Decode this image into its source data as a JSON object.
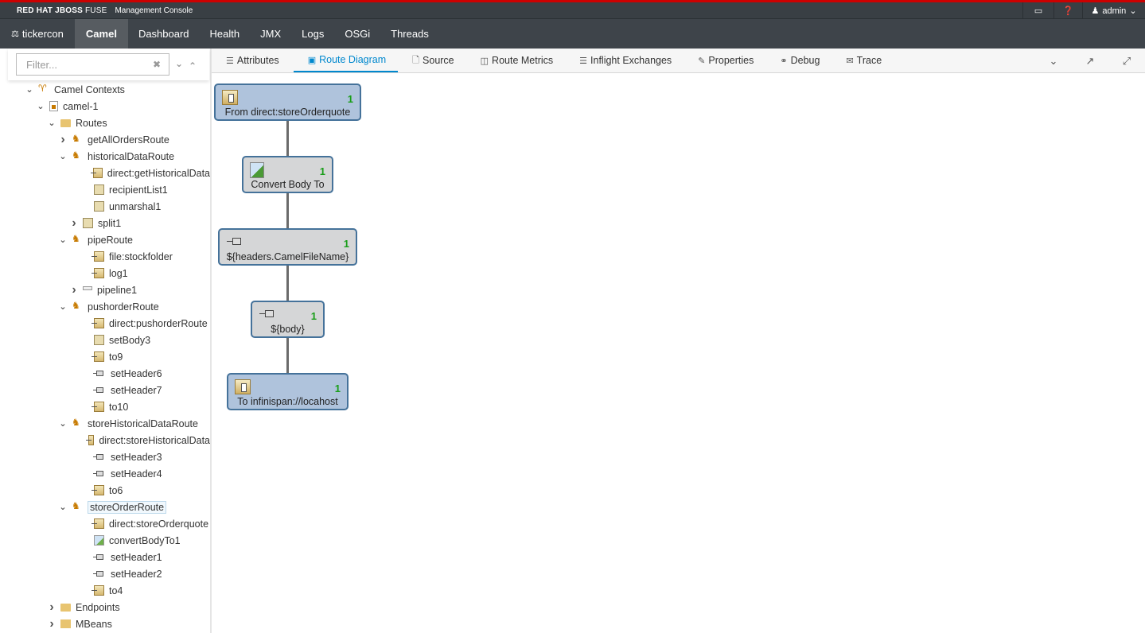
{
  "header": {
    "brand": "RED HAT JBOSS",
    "brand_product": "FUSE",
    "subtitle": "Management Console",
    "user": "admin"
  },
  "nav": {
    "items": [
      {
        "label": "tickercon",
        "icon": "flask-icon"
      },
      {
        "label": "Camel",
        "active": true
      },
      {
        "label": "Dashboard"
      },
      {
        "label": "Health"
      },
      {
        "label": "JMX"
      },
      {
        "label": "Logs"
      },
      {
        "label": "OSGi"
      },
      {
        "label": "Threads"
      }
    ]
  },
  "sidebar": {
    "filter_placeholder": "Filter...",
    "tree": {
      "root": "Camel Contexts",
      "context": "camel-1",
      "routes_folder": "Routes",
      "routes": [
        {
          "name": "getAllOrdersRoute",
          "expanded": false,
          "children": []
        },
        {
          "name": "historicalDataRoute",
          "expanded": true,
          "children": [
            "direct:getHistoricalData",
            "recipientList1",
            "unmarshal1",
            "split1"
          ]
        },
        {
          "name": "pipeRoute",
          "expanded": true,
          "children": [
            "file:stockfolder",
            "log1",
            "pipeline1"
          ]
        },
        {
          "name": "pushorderRoute",
          "expanded": true,
          "children": [
            "direct:pushorderRoute",
            "setBody3",
            "to9",
            "setHeader6",
            "setHeader7",
            "to10"
          ]
        },
        {
          "name": "storeHistoricalDataRoute",
          "expanded": true,
          "children": [
            "direct:storeHistoricalData",
            "setHeader3",
            "setHeader4",
            "to6"
          ]
        },
        {
          "name": "storeOrderRoute",
          "expanded": true,
          "selected": true,
          "children": [
            "direct:storeOrderquote",
            "convertBodyTo1",
            "setHeader1",
            "setHeader2",
            "to4"
          ]
        }
      ],
      "endpoints": "Endpoints",
      "mbeans": "MBeans"
    }
  },
  "tabs": [
    {
      "label": "Attributes",
      "icon": "list-icon"
    },
    {
      "label": "Route Diagram",
      "icon": "image-icon",
      "active": true
    },
    {
      "label": "Source",
      "icon": "file-icon"
    },
    {
      "label": "Route Metrics",
      "icon": "bar-chart-icon"
    },
    {
      "label": "Inflight Exchanges",
      "icon": "list-icon"
    },
    {
      "label": "Properties",
      "icon": "edit-icon"
    },
    {
      "label": "Debug",
      "icon": "stethoscope-icon"
    },
    {
      "label": "Trace",
      "icon": "envelope-icon"
    }
  ],
  "diagram": {
    "nodes": [
      {
        "label": "From direct:storeOrderquote",
        "count": "1",
        "kind": "endpoint"
      },
      {
        "label": "Convert Body To",
        "count": "1",
        "kind": "convert"
      },
      {
        "label": "${headers.CamelFileName}",
        "count": "1",
        "kind": "setheader"
      },
      {
        "label": "${body}",
        "count": "1",
        "kind": "setheader"
      },
      {
        "label": "To infinispan://locahost",
        "count": "1",
        "kind": "endpoint"
      }
    ]
  }
}
